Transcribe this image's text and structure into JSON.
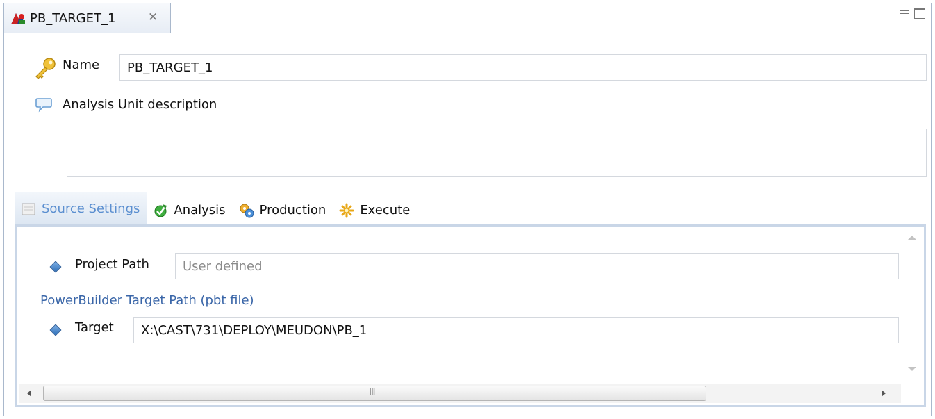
{
  "editor": {
    "tab_title": "PB_TARGET_1",
    "close_glyph": "✕"
  },
  "header": {
    "name_label": "Name",
    "name_value": "PB_TARGET_1",
    "description_label": "Analysis Unit description",
    "description_value": ""
  },
  "tabs": [
    {
      "label": "Source Settings",
      "icon": "source-settings-icon",
      "active": true
    },
    {
      "label": "Analysis",
      "icon": "analysis-icon",
      "active": false
    },
    {
      "label": "Production",
      "icon": "production-icon",
      "active": false
    },
    {
      "label": "Execute",
      "icon": "execute-icon",
      "active": false
    }
  ],
  "source_settings": {
    "project_path_label": "Project Path",
    "project_path_value": "User defined",
    "section_title": "PowerBuilder Target Path (pbt file)",
    "target_label": "Target",
    "target_value": "X:\\CAST\\731\\DEPLOY\\MEUDON\\PB_1"
  },
  "scrollbar": {
    "grip": "III"
  },
  "colors": {
    "accent_blue": "#5b8fd0",
    "section_blue": "#3a66a8",
    "border": "#a9b8cc"
  }
}
